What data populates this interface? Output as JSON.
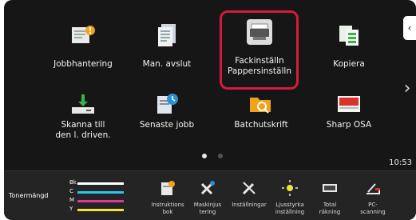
{
  "nav": {
    "collapse_glyph": "‹",
    "next_glyph": "›"
  },
  "tiles": [
    {
      "id": "jobbhantering",
      "label": "Jobbhantering",
      "icon": "job-status-icon"
    },
    {
      "id": "man-avslut",
      "label": "Man. avslut",
      "icon": "document-pages-icon"
    },
    {
      "id": "fackinstall",
      "label": "Fackinställn\nPappersinställn",
      "icon": "paper-tray-icon"
    },
    {
      "id": "kopiera",
      "label": "Kopiera",
      "icon": "copy-icon"
    },
    {
      "id": "skanna",
      "label": "Skanna till\nden l. driven.",
      "icon": "scan-to-drive-icon"
    },
    {
      "id": "senaste",
      "label": "Senaste jobb",
      "icon": "recent-jobs-icon"
    },
    {
      "id": "batch",
      "label": "Batchutskrift",
      "icon": "batch-print-folder-icon"
    },
    {
      "id": "sharp-osa",
      "label": "Sharp OSA",
      "icon": "sharp-osa-icon"
    }
  ],
  "pager": {
    "active": 0,
    "count": 2
  },
  "clock": "10:53",
  "toner": {
    "title": "Tonermängd",
    "colors": [
      {
        "letter": "Bk",
        "color": "#ffffff"
      },
      {
        "letter": "C",
        "color": "#2ec4ef"
      },
      {
        "letter": "M",
        "color": "#e0379b"
      },
      {
        "letter": "Y",
        "color": "#f4e23b"
      }
    ]
  },
  "shortcuts": [
    {
      "label": "Instruktions\nbok",
      "icon": "manual-book-icon"
    },
    {
      "label": "Maskinjus\ntering",
      "icon": "machine-adjust-icon"
    },
    {
      "label": "Inställningar",
      "icon": "settings-wrench-icon"
    },
    {
      "label": "Ljusstyrka\ninställning",
      "icon": "brightness-icon"
    },
    {
      "label": "Total\nräkning",
      "icon": "total-count-icon"
    },
    {
      "label": "PC-\nscanning",
      "icon": "pc-scan-icon"
    }
  ]
}
